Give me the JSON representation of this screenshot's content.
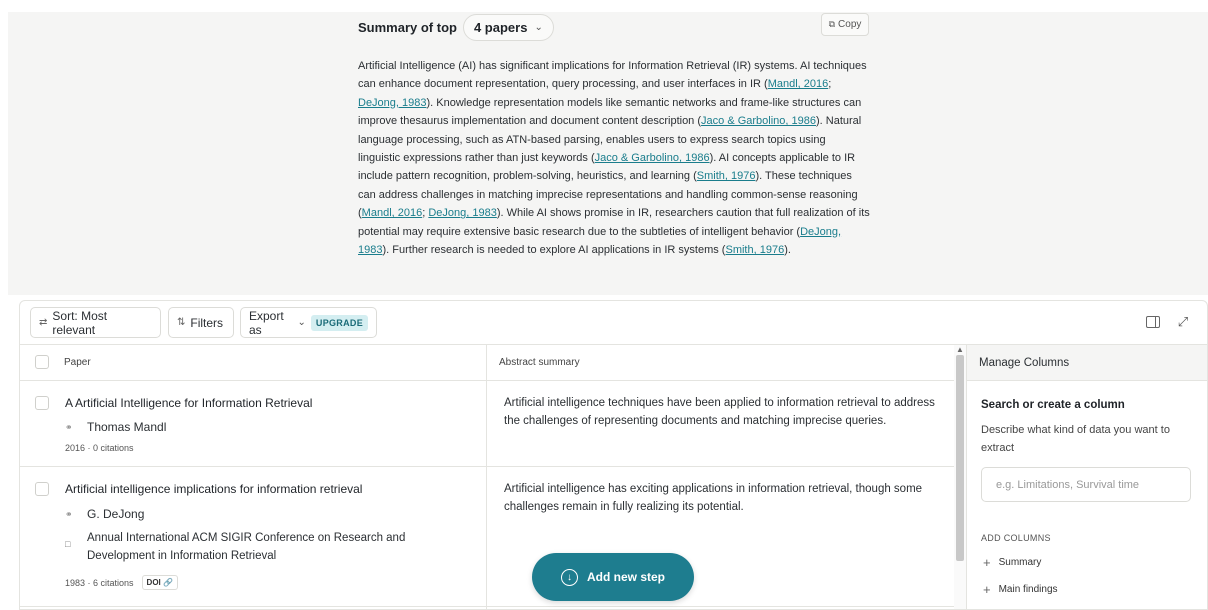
{
  "summary": {
    "title": "Summary of top",
    "papers_dropdown": "4 papers",
    "copy_label": "Copy",
    "text_segments": [
      {
        "t": "Artificial Intelligence (AI) has significant implications for Information Retrieval (IR) systems. AI techniques can enhance document representation, query processing, and user interfaces in IR ("
      },
      {
        "t": "Mandl, 2016",
        "cite": true
      },
      {
        "t": "; "
      },
      {
        "t": "DeJong, 1983",
        "cite": true
      },
      {
        "t": "). Knowledge representation models like semantic networks and frame-like structures can improve thesaurus implementation and document content description ("
      },
      {
        "t": "Jaco & Garbolino, 1986",
        "cite": true
      },
      {
        "t": "). Natural language processing, such as ATN-based parsing, enables users to express search topics using linguistic expressions rather than just keywords ("
      },
      {
        "t": "Jaco & Garbolino, 1986",
        "cite": true
      },
      {
        "t": "). AI concepts applicable to IR include pattern recognition, problem-solving, heuristics, and learning ("
      },
      {
        "t": "Smith, 1976",
        "cite": true
      },
      {
        "t": "). These techniques can address challenges in matching imprecise representations and handling common-sense reasoning ("
      },
      {
        "t": "Mandl, 2016",
        "cite": true
      },
      {
        "t": "; "
      },
      {
        "t": "DeJong, 1983",
        "cite": true
      },
      {
        "t": "). While AI shows promise in IR, researchers caution that full realization of its potential may require extensive basic research due to the subtleties of intelligent behavior ("
      },
      {
        "t": "DeJong, 1983",
        "cite": true
      },
      {
        "t": "). Further research is needed to explore AI applications in IR systems ("
      },
      {
        "t": "Smith, 1976",
        "cite": true
      },
      {
        "t": ")."
      }
    ]
  },
  "toolbar": {
    "sort_label": "Sort: Most relevant",
    "filters_label": "Filters",
    "export_label": "Export as",
    "upgrade_label": "UPGRADE"
  },
  "table": {
    "col_paper": "Paper",
    "col_abstract": "Abstract summary",
    "rows": [
      {
        "title": "A Artificial Intelligence for Information Retrieval",
        "author": "Thomas Mandl",
        "meta": "2016 · 0 citations",
        "abstract": "Artificial intelligence techniques have been applied to information retrieval to address the challenges of representing documents and matching imprecise queries."
      },
      {
        "title": "Artificial intelligence implications for information retrieval",
        "author": "G. DeJong",
        "venue": "Annual International ACM SIGIR Conference on Research and Development in Information Retrieval",
        "meta": "1983 · 6 citations",
        "doi": "DOI",
        "abstract": "Artificial intelligence has exciting applications in information retrieval, though some challenges remain in fully realizing its potential."
      }
    ]
  },
  "manage": {
    "header": "Manage Columns",
    "title": "Search or create a column",
    "desc": "Describe what kind of data you want to extract",
    "placeholder": "e.g. Limitations, Survival time",
    "section": "ADD COLUMNS",
    "add_items": [
      "Summary",
      "Main findings"
    ]
  },
  "fab": {
    "label": "Add new step"
  },
  "colors": {
    "accent": "#1e7d8f",
    "link": "#1a7d8c",
    "panel_bg": "#f5f5f4"
  }
}
